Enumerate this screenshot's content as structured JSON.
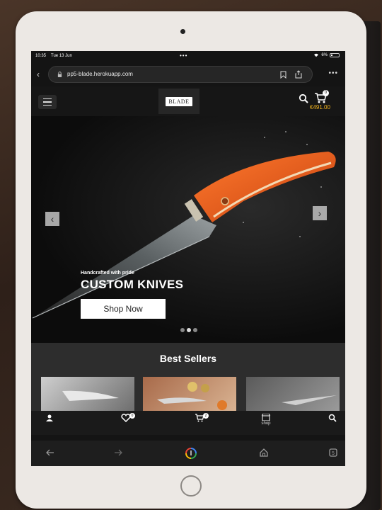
{
  "status_bar": {
    "time": "10:35",
    "date": "Tue 13 Jun",
    "battery": "6%"
  },
  "browser": {
    "url": "pp5-blade.herokuapp.com"
  },
  "header": {
    "logo_text": "BLADE",
    "cart_count": "0",
    "cart_total": "€491.00"
  },
  "hero": {
    "tagline": "Handcrafted with pride",
    "title": "CUSTOM KNIVES",
    "cta": "Shop Now",
    "slide_count": 3,
    "active_slide": 2
  },
  "best_sellers": {
    "title": "Best Sellers"
  },
  "bottom_nav": {
    "account_icon": "user-icon",
    "wishlist_count": "0",
    "cart_count": "2",
    "shop_label": "shop",
    "search_icon": "search-icon"
  },
  "colors": {
    "accent": "#f0b21c",
    "header_bg": "#161616",
    "section_bg": "#2d2d2d"
  }
}
